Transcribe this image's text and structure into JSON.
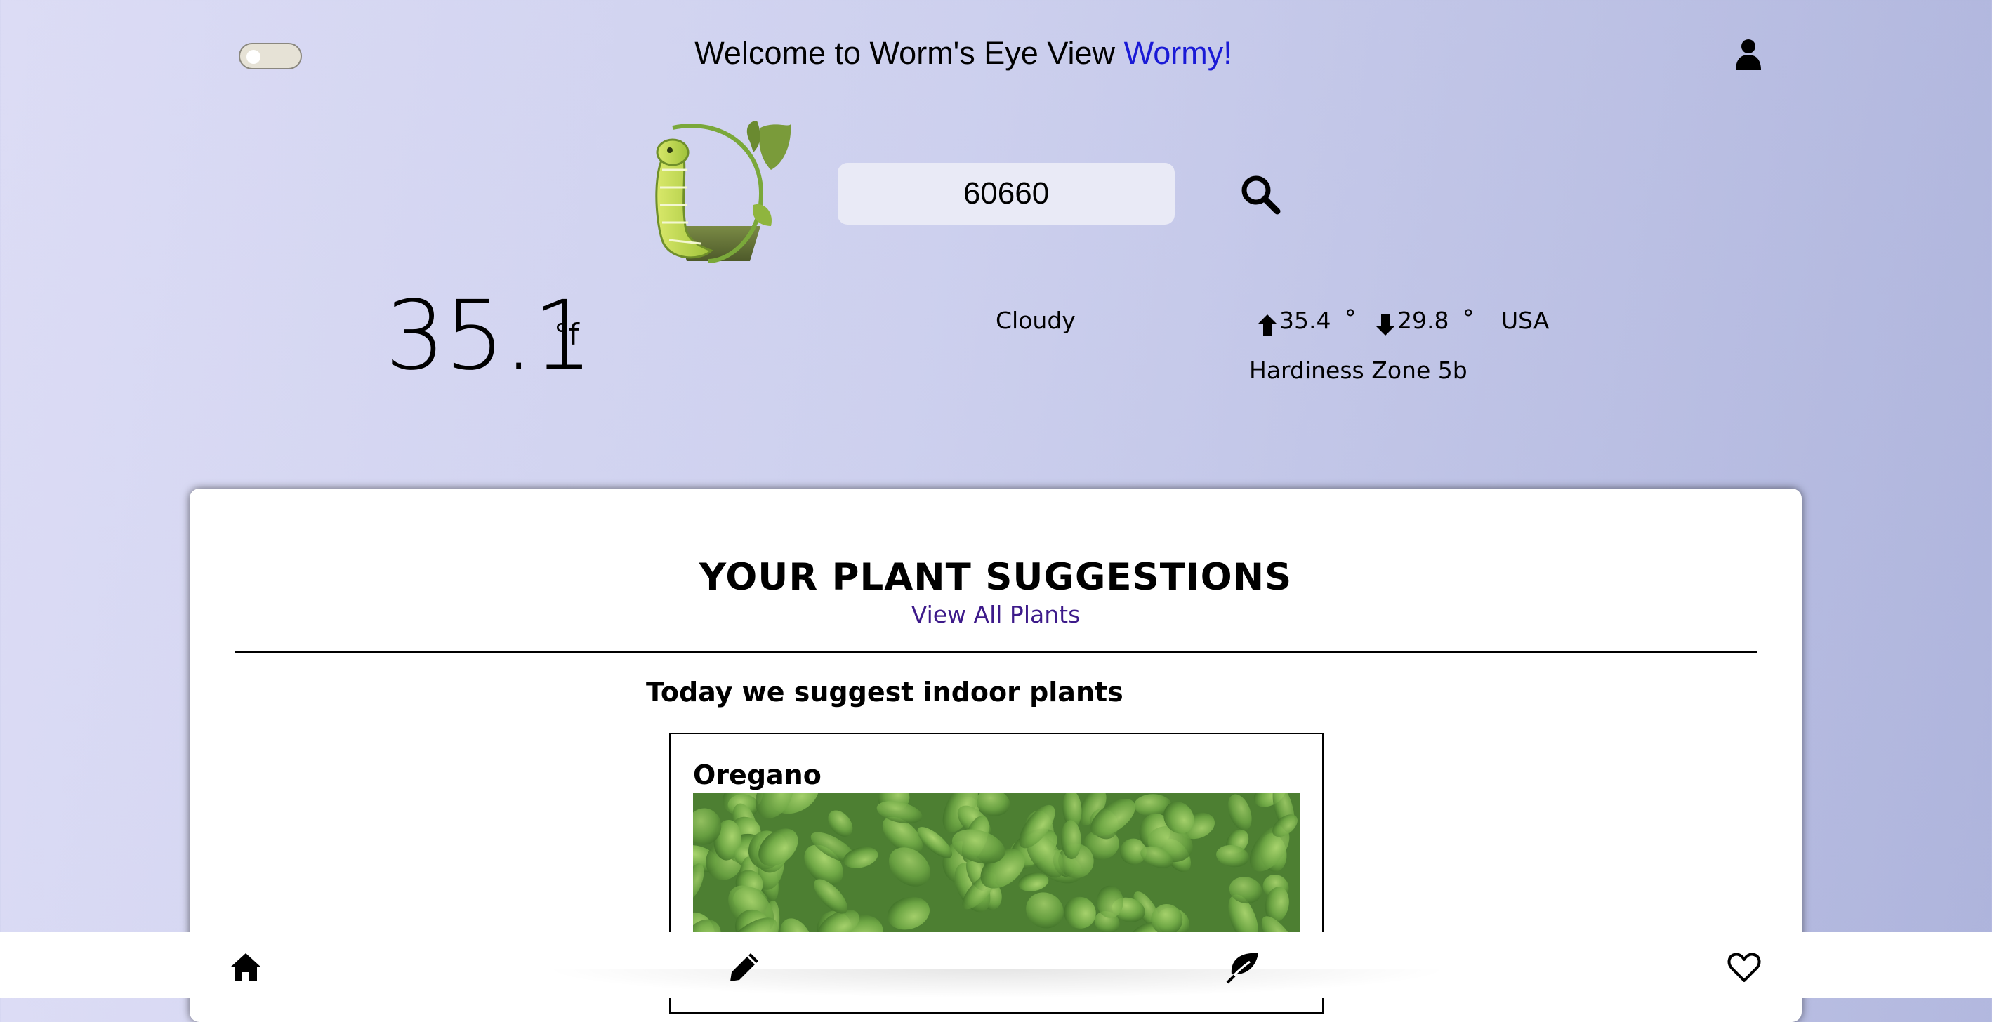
{
  "header": {
    "welcome_text": "Welcome to Worm's Eye View",
    "user_name": "Wormy!"
  },
  "search": {
    "value": "60660"
  },
  "weather": {
    "temperature": "35.1",
    "unit": "°f",
    "condition": "Cloudy",
    "high": "35.4",
    "low": "29.8",
    "degree_symbol": "°",
    "country": "USA",
    "hardiness_zone": "Hardiness Zone 5b"
  },
  "suggestions": {
    "title": "YOUR PLANT SUGGESTIONS",
    "view_all_label": "View All Plants",
    "subtitle": "Today we suggest indoor plants",
    "plants": [
      {
        "name": "Oregano"
      }
    ]
  },
  "nav": {
    "icons": [
      "home-icon",
      "pencil-icon",
      "leaf-icon",
      "heart-icon"
    ]
  },
  "colors": {
    "accent": "#1a1ad6",
    "link": "#3d1a8a"
  }
}
